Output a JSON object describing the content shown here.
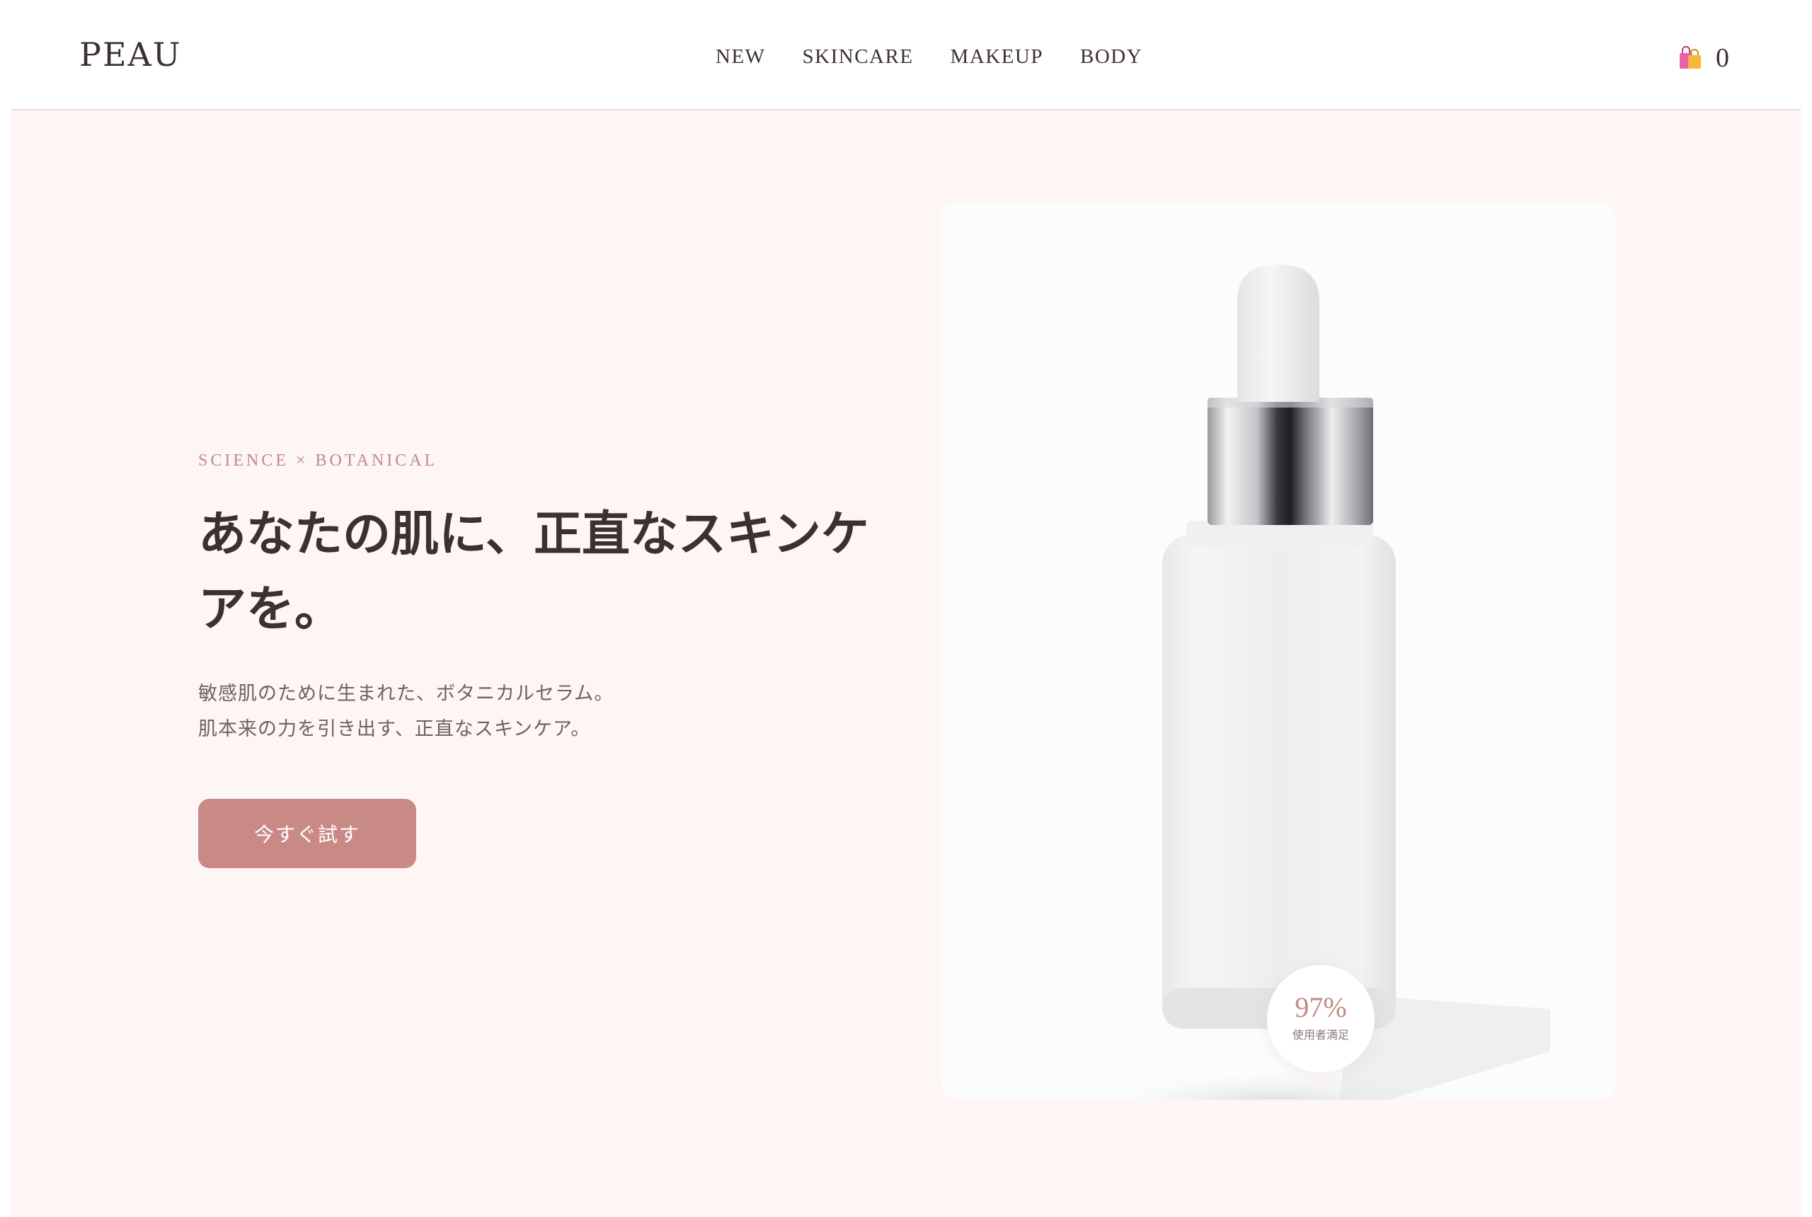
{
  "header": {
    "logo": "PEAU",
    "nav": [
      "NEW",
      "SKINCARE",
      "MAKEUP",
      "BODY"
    ],
    "cart_count": "0",
    "cart_icon": "shopping-bags-icon"
  },
  "hero": {
    "eyebrow": "SCIENCE × BOTANICAL",
    "headline": "あなたの肌に、正直なスキンケアを。",
    "subtext_lines": [
      "敏感肌のために生まれた、ボタニカルセラム。",
      "肌本来の力を引き出す、正直なスキンケア。"
    ],
    "cta_label": "今すぐ試す"
  },
  "product": {
    "image": "serum-dropper-bottle",
    "badge_value": "97%",
    "badge_label": "使用者満足"
  },
  "colors": {
    "accent": "#c98a86",
    "hero_background": "#fdf6f4",
    "text": "#3d3030"
  }
}
